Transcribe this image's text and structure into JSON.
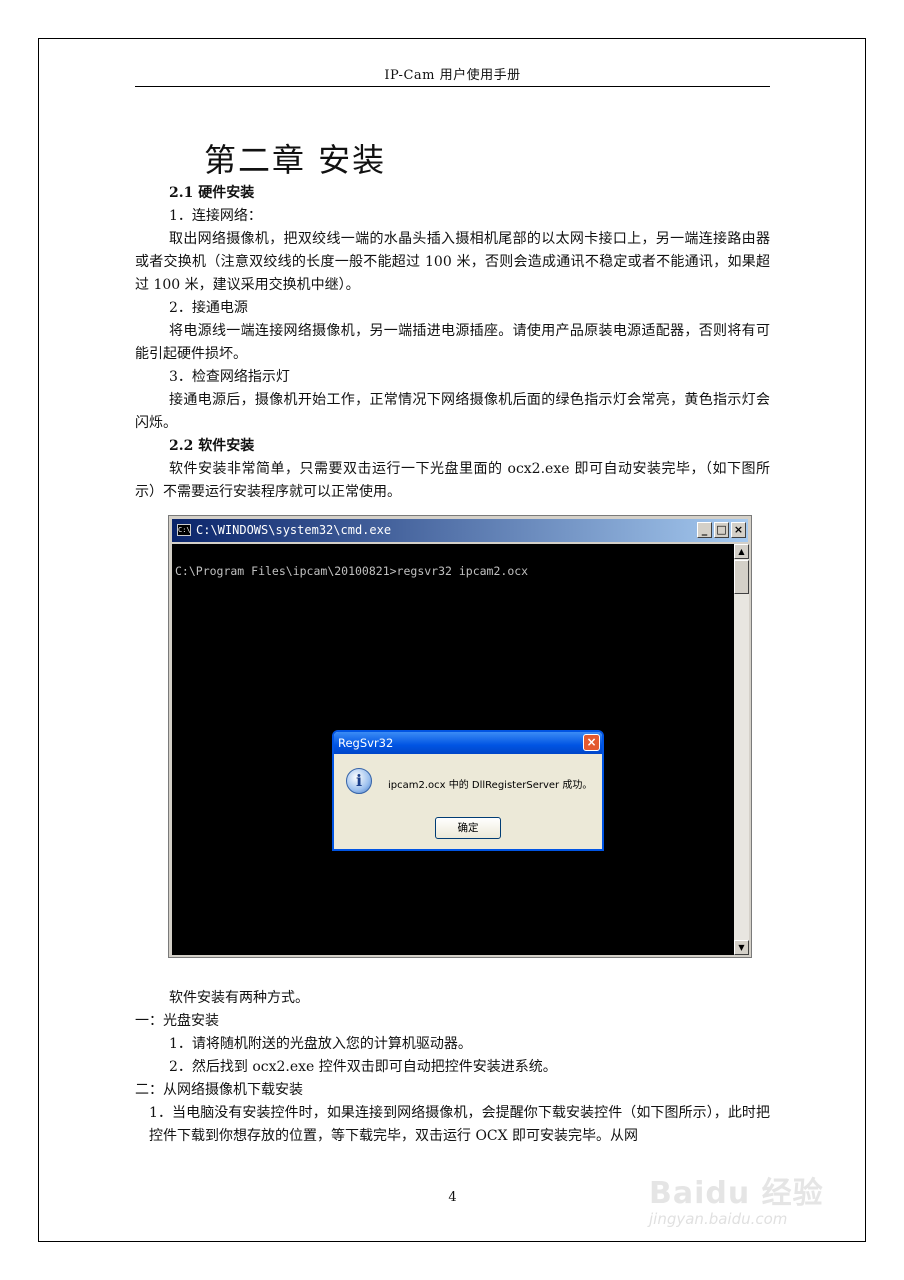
{
  "header": {
    "title": "IP-Cam 用户使用手册"
  },
  "chapter": {
    "title": "第二章  安装"
  },
  "section1": {
    "heading": "2.1  硬件安装",
    "step1_title": "1．连接网络：",
    "step1_text": "取出网络摄像机，把双绞线一端的水晶头插入摄相机尾部的以太网卡接口上，另一端连接路由器或者交换机（注意双绞线的长度一般不能超过 100 米，否则会造成通讯不稳定或者不能通讯，如果超过 100 米，建议采用交换机中继）。",
    "step2_title": "2．接通电源",
    "step2_text": "将电源线一端连接网络摄像机，另一端插进电源插座。请使用产品原装电源适配器，否则将有可能引起硬件损坏。",
    "step3_title": "3．检查网络指示灯",
    "step3_text": "接通电源后，摄像机开始工作，正常情况下网络摄像机后面的绿色指示灯会常亮，黄色指示灯会闪烁。"
  },
  "section2": {
    "heading": "2.2  软件安装",
    "intro": "软件安装非常简单，只需要双击运行一下光盘里面的 ocx2.exe 即可自动安装完毕，（如下图所示）不需要运行安装程序就可以正常使用。"
  },
  "screenshot": {
    "window_title": "C:\\WINDOWS\\system32\\cmd.exe",
    "icon_label": "C:\\",
    "minimize": "_",
    "maximize": "□",
    "close": "×",
    "command_line": "C:\\Program Files\\ipcam\\20100821>regsvr32 ipcam2.ocx",
    "scroll_up": "▲",
    "scroll_down": "▼",
    "dialog": {
      "title": "RegSvr32",
      "close": "×",
      "icon": "i",
      "message": "ipcam2.ocx 中的 DllRegisterServer 成功。",
      "ok_label": "确定"
    }
  },
  "section3": {
    "intro": "软件安装有两种方式。",
    "method1_title": "一：光盘安装",
    "method1_step1": "1．请将随机附送的光盘放入您的计算机驱动器。",
    "method1_step2": "2．然后找到 ocx2.exe 控件双击即可自动把控件安装进系统。",
    "method2_title": "二：从网络摄像机下载安装",
    "method2_step1": "1．当电脑没有安装控件时，如果连接到网络摄像机，会提醒你下载安装控件（如下图所示），此时把控件下载到你想存放的位置，等下载完毕，双击运行 OCX 即可安装完毕。从网"
  },
  "footer": {
    "page_number": "4"
  },
  "watermark": {
    "brand": "Baidu 经验",
    "url": "jingyan.baidu.com"
  }
}
